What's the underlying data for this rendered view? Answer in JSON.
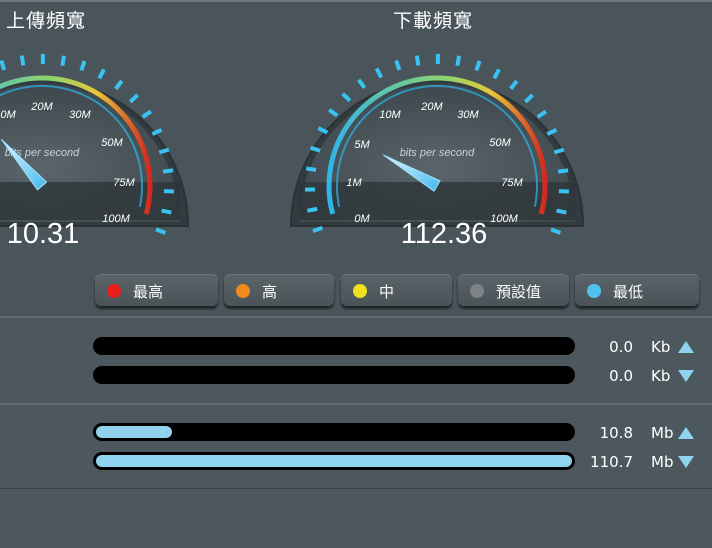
{
  "titles": {
    "upload": "上傳頻寬",
    "download": "下載頻寬"
  },
  "gauge_unit_label": "bits per second",
  "upload_gauge": {
    "value": "10.31",
    "tick_labels": [
      "0M",
      "20M",
      "30M",
      "50M",
      "75M",
      "100M"
    ]
  },
  "download_gauge": {
    "value": "112.36",
    "tick_labels": [
      "0M",
      "1M",
      "5M",
      "10M",
      "20M",
      "30M",
      "50M",
      "75M",
      "100M"
    ]
  },
  "legend": [
    {
      "label": "最高",
      "color": "#e8201a"
    },
    {
      "label": "高",
      "color": "#ef8a1c"
    },
    {
      "label": "中",
      "color": "#f2e11a"
    },
    {
      "label": "預設值",
      "color": "#7d8386"
    },
    {
      "label": "最低",
      "color": "#4fc3ee"
    }
  ],
  "rows": [
    {
      "value": "0.0",
      "unit": "Kb",
      "direction": "up",
      "fill": 0
    },
    {
      "value": "0.0",
      "unit": "Kb",
      "direction": "down",
      "fill": 0
    },
    {
      "value": "10.8",
      "unit": "Mb",
      "direction": "up",
      "fill": 0.16
    },
    {
      "value": "110.7",
      "unit": "Mb",
      "direction": "down",
      "fill": 1.0
    }
  ],
  "colors": {
    "accent": "#8fd3ef",
    "background": "#4a555b",
    "gauge_glow": "#2fb5ea"
  }
}
